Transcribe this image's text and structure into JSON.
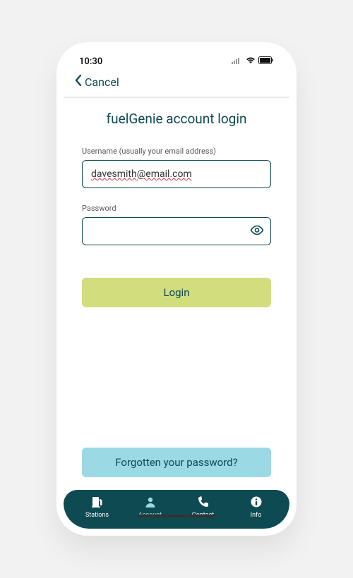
{
  "statusbar": {
    "time": "10:30"
  },
  "nav": {
    "cancel": "Cancel"
  },
  "page": {
    "title": "fuelGenie account login"
  },
  "username": {
    "label": "Username (usually your email address)",
    "value": "davesmith@email.com"
  },
  "password": {
    "label": "Password",
    "value": ""
  },
  "buttons": {
    "login": "Login",
    "forgot": "Forgotten your password?"
  },
  "tabs": {
    "stations": "Stations",
    "account": "Account",
    "contact": "Contact",
    "info": "Info"
  },
  "colors": {
    "brand": "#0d4a52",
    "accent_green": "#d2dd7e",
    "accent_blue": "#9bd9e4"
  }
}
